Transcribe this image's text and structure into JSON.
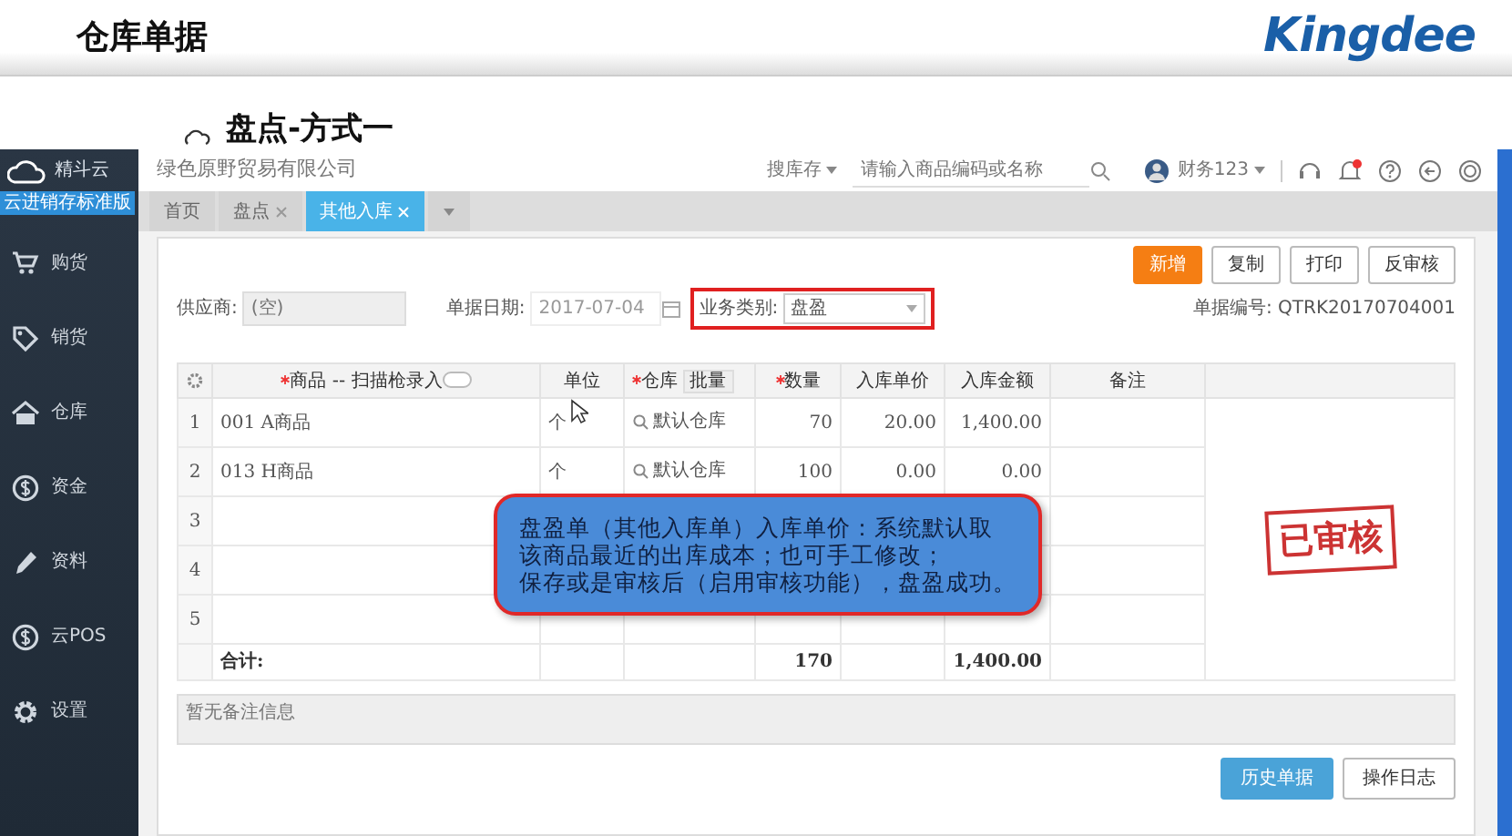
{
  "header": {
    "title": "仓库单据",
    "logo": "Kingdee"
  },
  "slide_title": "盘点-方式一",
  "sidebar": {
    "brand": "精斗云",
    "edition": "云进销存标准版",
    "items": [
      {
        "label": "购货",
        "kind": "cart"
      },
      {
        "label": "销货",
        "kind": "tag"
      },
      {
        "label": "仓库",
        "kind": "house"
      },
      {
        "label": "资金",
        "kind": "coin"
      },
      {
        "label": "资料",
        "kind": "pencil"
      },
      {
        "label": "云POS",
        "kind": "coin"
      },
      {
        "label": "设置",
        "kind": "gear"
      }
    ]
  },
  "topbar": {
    "company": "绿色原野贸易有限公司",
    "search_scope": "搜库存",
    "search_placeholder": "请输入商品编码或名称",
    "user": "财务123"
  },
  "tabs": [
    {
      "label": "首页",
      "closable": false,
      "selected": false
    },
    {
      "label": "盘点",
      "closable": true,
      "selected": false
    },
    {
      "label": "其他入库",
      "closable": true,
      "selected": true
    }
  ],
  "toolbar": [
    {
      "label": "新增",
      "primary": true
    },
    {
      "label": "复制",
      "primary": false
    },
    {
      "label": "打印",
      "primary": false
    },
    {
      "label": "反审核",
      "primary": false
    }
  ],
  "form": {
    "supplier_label": "供应商:",
    "supplier_placeholder": "(空)",
    "date_label": "单据日期:",
    "date_value": "2017-07-04",
    "type_label": "业务类别:",
    "type_value": "盘盈",
    "type_highlighted": true,
    "doc_no_label": "单据编号:",
    "doc_no": "QTRK20170704001"
  },
  "table": {
    "columns": [
      {
        "label": "商品 -- 扫描枪录入",
        "required": true
      },
      {
        "label": "单位",
        "required": false
      },
      {
        "label": "仓库",
        "required": true
      },
      {
        "label": "数量",
        "required": true
      },
      {
        "label": "入库单价",
        "required": false
      },
      {
        "label": "入库金额",
        "required": false
      },
      {
        "label": "备注",
        "required": false
      }
    ],
    "scan_toggle_on": false,
    "batch_button": "批量",
    "rows": [
      {
        "index": "1",
        "cells": [
          "001 A商品",
          "个",
          "默认仓库",
          "70",
          "20.00",
          "1,400.00",
          ""
        ]
      },
      {
        "index": "2",
        "cells": [
          "013 H商品",
          "个",
          "默认仓库",
          "100",
          "0.00",
          "0.00",
          ""
        ]
      },
      {
        "index": "3",
        "cells": [
          "",
          "",
          "",
          "",
          "",
          "",
          ""
        ]
      },
      {
        "index": "4",
        "cells": [
          "",
          "",
          "",
          "",
          "",
          "",
          ""
        ]
      },
      {
        "index": "5",
        "cells": [
          "",
          "",
          "",
          "",
          "",
          "",
          ""
        ]
      }
    ],
    "total": {
      "label": "合计:",
      "cells": [
        "",
        "",
        "",
        "170",
        "",
        "1,400.00",
        ""
      ]
    },
    "stamp": "已审核"
  },
  "remark_placeholder": "暂无备注信息",
  "footer_buttons": [
    {
      "label": "历史单据",
      "primary": true
    },
    {
      "label": "操作日志",
      "primary": false
    }
  ],
  "callout": {
    "lines": [
      "盘盈单（其他入库单）入库单价：系统默认取",
      "该商品最近的出库成本；也可手工修改；",
      "保存或是审核后（启用审核功能），盘盈成功。"
    ]
  }
}
